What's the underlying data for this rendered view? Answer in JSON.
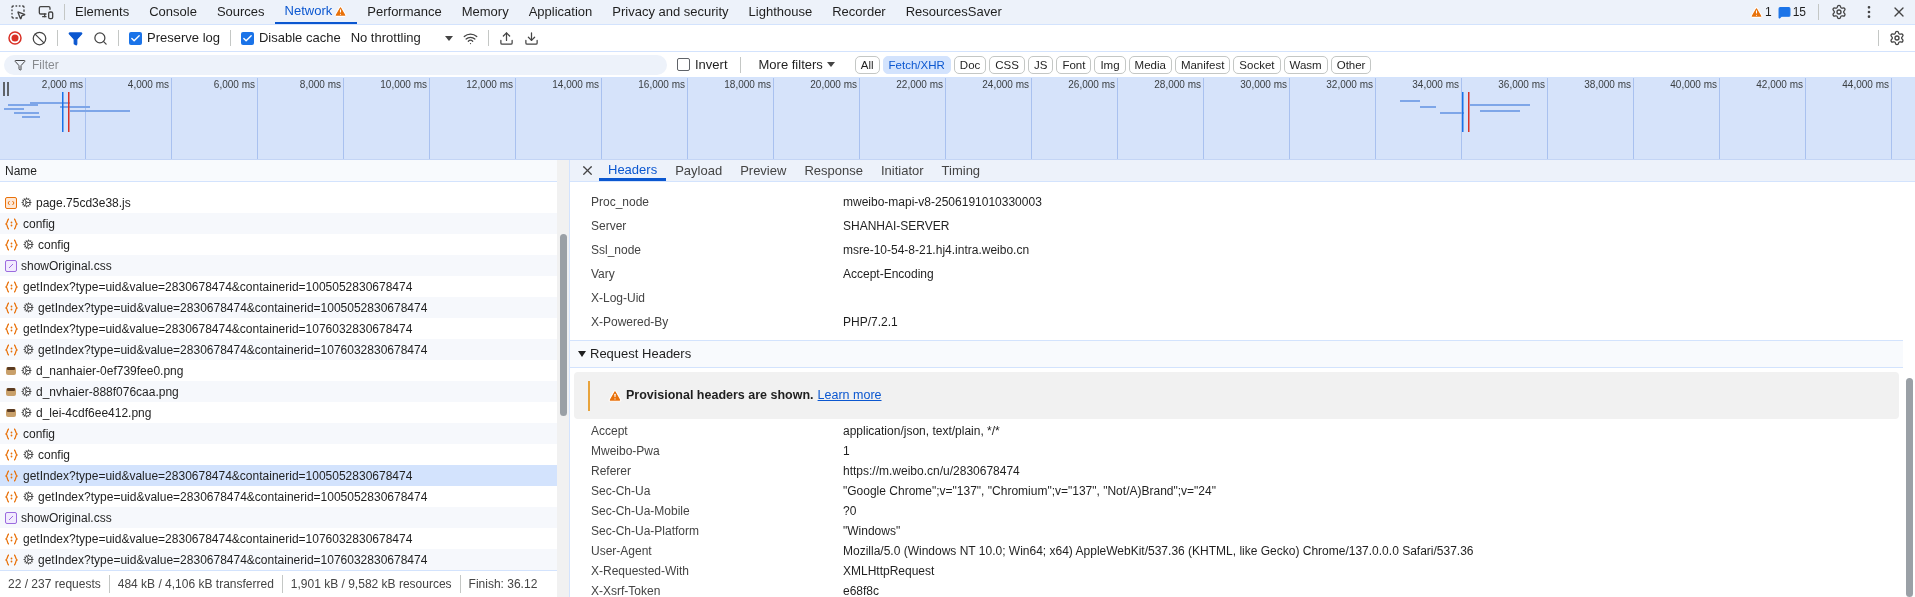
{
  "top_tabs": [
    {
      "label": "Elements",
      "selected": false,
      "alert": false
    },
    {
      "label": "Console",
      "selected": false,
      "alert": false
    },
    {
      "label": "Sources",
      "selected": false,
      "alert": false
    },
    {
      "label": "Network",
      "selected": true,
      "alert": true
    },
    {
      "label": "Performance",
      "selected": false,
      "alert": false
    },
    {
      "label": "Memory",
      "selected": false,
      "alert": false
    },
    {
      "label": "Application",
      "selected": false,
      "alert": false
    },
    {
      "label": "Privacy and security",
      "selected": false,
      "alert": false
    },
    {
      "label": "Lighthouse",
      "selected": false,
      "alert": false
    },
    {
      "label": "Recorder",
      "selected": false,
      "alert": false
    },
    {
      "label": "ResourcesSaver",
      "selected": false,
      "alert": false
    }
  ],
  "top_status": {
    "warnings": "1",
    "messages": "15"
  },
  "toolbar": {
    "recording": true,
    "filter_active": true,
    "preserve_log": {
      "label": "Preserve log",
      "checked": true
    },
    "disable_cache": {
      "label": "Disable cache",
      "checked": true
    },
    "throttling": "No throttling"
  },
  "filter_bar": {
    "placeholder": "Filter",
    "invert": {
      "label": "Invert",
      "checked": false
    },
    "more_filters": "More filters",
    "types": [
      {
        "label": "All",
        "selected": false
      },
      {
        "label": "Fetch/XHR",
        "selected": true
      },
      {
        "label": "Doc",
        "selected": false
      },
      {
        "label": "CSS",
        "selected": false
      },
      {
        "label": "JS",
        "selected": false
      },
      {
        "label": "Font",
        "selected": false
      },
      {
        "label": "Img",
        "selected": false
      },
      {
        "label": "Media",
        "selected": false
      },
      {
        "label": "Manifest",
        "selected": false
      },
      {
        "label": "Socket",
        "selected": false
      },
      {
        "label": "Wasm",
        "selected": false
      },
      {
        "label": "Other",
        "selected": false
      }
    ]
  },
  "overview": {
    "ticks": [
      "2,000 ms",
      "4,000 ms",
      "6,000 ms",
      "8,000 ms",
      "10,000 ms",
      "12,000 ms",
      "14,000 ms",
      "16,000 ms",
      "18,000 ms",
      "20,000 ms",
      "22,000 ms",
      "24,000 ms",
      "26,000 ms",
      "28,000 ms",
      "30,000 ms",
      "32,000 ms",
      "34,000 ms",
      "36,000 ms",
      "38,000 ms",
      "40,000 ms",
      "42,000 ms",
      "44,000 ms"
    ]
  },
  "requests": {
    "column": "Name",
    "rows": [
      {
        "name": "page.75cd3e38.js",
        "kind": "script",
        "service_worker": true,
        "selected": false
      },
      {
        "name": "config",
        "kind": "fetch",
        "service_worker": false,
        "selected": false
      },
      {
        "name": "config",
        "kind": "fetch",
        "service_worker": true,
        "selected": false
      },
      {
        "name": "showOriginal.css",
        "kind": "style",
        "service_worker": false,
        "selected": false
      },
      {
        "name": "getIndex?type=uid&value=2830678474&containerid=1005052830678474",
        "kind": "fetch",
        "service_worker": false,
        "selected": false
      },
      {
        "name": "getIndex?type=uid&value=2830678474&containerid=1005052830678474",
        "kind": "fetch",
        "service_worker": true,
        "selected": false
      },
      {
        "name": "getIndex?type=uid&value=2830678474&containerid=1076032830678474",
        "kind": "fetch",
        "service_worker": false,
        "selected": false
      },
      {
        "name": "getIndex?type=uid&value=2830678474&containerid=1076032830678474",
        "kind": "fetch",
        "service_worker": true,
        "selected": false
      },
      {
        "name": "d_nanhaier-0ef739fee0.png",
        "kind": "image",
        "service_worker": true,
        "selected": false
      },
      {
        "name": "d_nvhaier-888f076caa.png",
        "kind": "image",
        "service_worker": true,
        "selected": false
      },
      {
        "name": "d_lei-4cdf6ee412.png",
        "kind": "image",
        "service_worker": true,
        "selected": false
      },
      {
        "name": "config",
        "kind": "fetch",
        "service_worker": false,
        "selected": false
      },
      {
        "name": "config",
        "kind": "fetch",
        "service_worker": true,
        "selected": false
      },
      {
        "name": "getIndex?type=uid&value=2830678474&containerid=1005052830678474",
        "kind": "fetch",
        "service_worker": false,
        "selected": true
      },
      {
        "name": "getIndex?type=uid&value=2830678474&containerid=1005052830678474",
        "kind": "fetch",
        "service_worker": true,
        "selected": false
      },
      {
        "name": "showOriginal.css",
        "kind": "style",
        "service_worker": false,
        "selected": false
      },
      {
        "name": "getIndex?type=uid&value=2830678474&containerid=1076032830678474",
        "kind": "fetch",
        "service_worker": false,
        "selected": false
      },
      {
        "name": "getIndex?type=uid&value=2830678474&containerid=1076032830678474",
        "kind": "fetch",
        "service_worker": true,
        "selected": false
      }
    ]
  },
  "status_bar": [
    "22 / 237 requests",
    "484 kB / 4,106 kB transferred",
    "1,901 kB / 9,582 kB resources",
    "Finish: 36.12"
  ],
  "details": {
    "tabs": [
      {
        "label": "Headers",
        "selected": true
      },
      {
        "label": "Payload",
        "selected": false
      },
      {
        "label": "Preview",
        "selected": false
      },
      {
        "label": "Response",
        "selected": false
      },
      {
        "label": "Initiator",
        "selected": false
      },
      {
        "label": "Timing",
        "selected": false
      }
    ],
    "response_headers": [
      {
        "name": "Proc_node",
        "value": "mweibo-mapi-v8-2506191010330003"
      },
      {
        "name": "Server",
        "value": "SHANHAI-SERVER"
      },
      {
        "name": "Ssl_node",
        "value": "msre-10-54-8-21.hj4.intra.weibo.cn"
      },
      {
        "name": "Vary",
        "value": "Accept-Encoding"
      },
      {
        "name": "X-Log-Uid"
      },
      {
        "name": "X-Powered-By",
        "value": "PHP/7.2.1"
      }
    ],
    "request_section": {
      "title": "Request Headers",
      "expanded": true
    },
    "provisional": {
      "text": "Provisional headers are shown.",
      "link": "Learn more"
    },
    "request_headers": [
      {
        "name": "Accept",
        "value": "application/json, text/plain, */*"
      },
      {
        "name": "Mweibo-Pwa",
        "value": "1"
      },
      {
        "name": "Referer",
        "value": "https://m.weibo.cn/u/2830678474"
      },
      {
        "name": "Sec-Ch-Ua",
        "value": "\"Google Chrome\";v=\"137\", \"Chromium\";v=\"137\", \"Not/A)Brand\";v=\"24\""
      },
      {
        "name": "Sec-Ch-Ua-Mobile",
        "value": "?0"
      },
      {
        "name": "Sec-Ch-Ua-Platform",
        "value": "\"Windows\""
      },
      {
        "name": "User-Agent",
        "value": "Mozilla/5.0 (Windows NT 10.0; Win64; x64) AppleWebKit/537.36 (KHTML, like Gecko) Chrome/137.0.0.0 Safari/537.36"
      },
      {
        "name": "X-Requested-With",
        "value": "XMLHttpRequest"
      },
      {
        "name": "X-Xsrf-Token",
        "value": "e68f8c"
      }
    ]
  }
}
